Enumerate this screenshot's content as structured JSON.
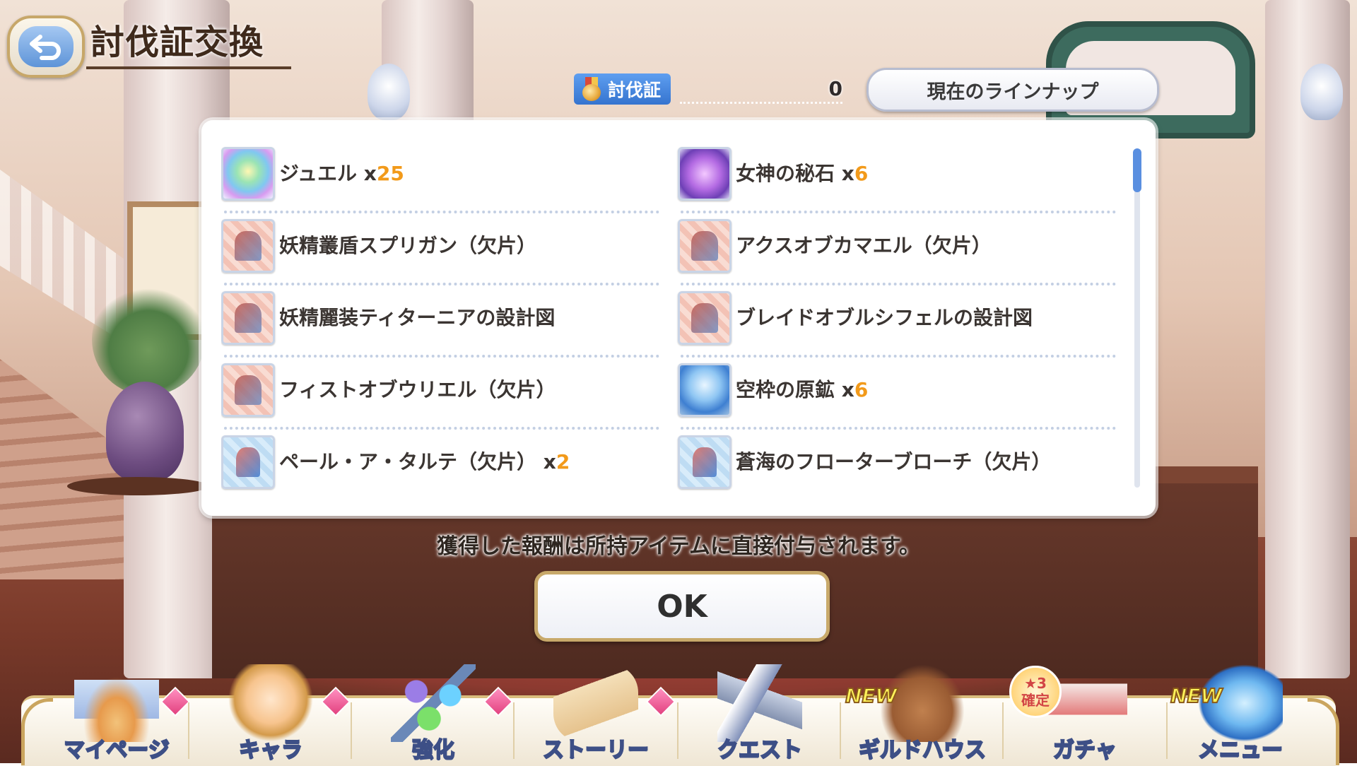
{
  "header": {
    "title": "討伐証交換",
    "back_icon": "back-arrow-icon"
  },
  "currency": {
    "label": "討伐証",
    "count": "0"
  },
  "lineup_button": "現在のラインナップ",
  "items": [
    {
      "name": "ジュエル",
      "qty_prefix": "x",
      "qty": "25",
      "icon": "jewel-icon"
    },
    {
      "name": "女神の秘石",
      "qty_prefix": "x",
      "qty": "6",
      "icon": "goddess-stone-icon"
    },
    {
      "name": "妖精叢盾スプリガン（欠片）",
      "qty_prefix": "",
      "qty": "",
      "icon": "equipment-fragment-icon"
    },
    {
      "name": "アクスオブカマエル（欠片）",
      "qty_prefix": "",
      "qty": "",
      "icon": "equipment-fragment-icon"
    },
    {
      "name": "妖精麗装ティターニアの設計図",
      "qty_prefix": "",
      "qty": "",
      "icon": "blueprint-icon"
    },
    {
      "name": "ブレイドオブルシフェルの設計図",
      "qty_prefix": "",
      "qty": "",
      "icon": "blueprint-icon"
    },
    {
      "name": "フィストオブウリエル（欠片）",
      "qty_prefix": "",
      "qty": "",
      "icon": "equipment-fragment-icon"
    },
    {
      "name": "空枠の原鉱",
      "qty_prefix": "x",
      "qty": "6",
      "icon": "ore-icon"
    },
    {
      "name": "ペール・ア・タルテ（欠片）",
      "qty_prefix": "x",
      "qty": "2",
      "icon": "equipment-fragment-icon"
    },
    {
      "name": "蒼海のフローターブローチ（欠片）",
      "qty_prefix": "",
      "qty": "",
      "icon": "equipment-fragment-icon"
    }
  ],
  "notice": "獲得した報酬は所持アイテムに直接付与されます。",
  "ok_button": "OK",
  "nav": {
    "mypage": "マイページ",
    "chara": "キャラ",
    "enhance": "強化",
    "story": "ストーリー",
    "quest": "クエスト",
    "guildhouse": "ギルドハウス",
    "gacha": "ガチャ",
    "menu": "メニュー",
    "new_badge": "NEW",
    "gacha_badge_line1": "★3",
    "gacha_badge_line2": "確定"
  },
  "colors": {
    "accent_blue": "#3574cf",
    "quantity_orange": "#f29a1a",
    "notification_pink": "#e2417f"
  }
}
